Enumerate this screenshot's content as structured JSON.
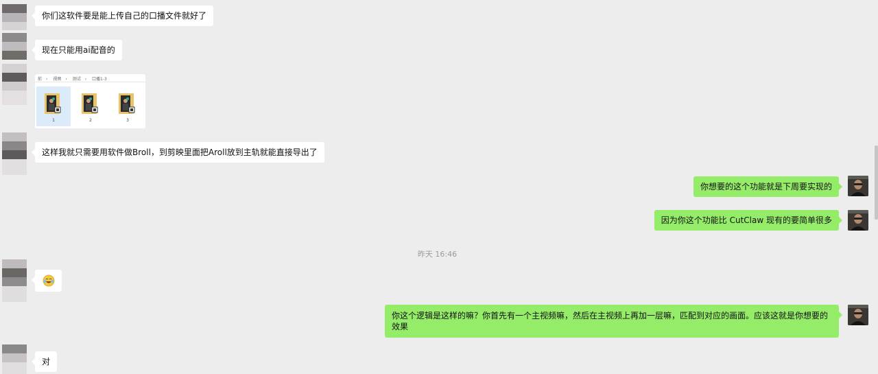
{
  "chat": {
    "messages": [
      {
        "text": "你们这软件要是能上传自己的口播文件就好了"
      },
      {
        "text": "现在只能用ai配音的"
      },
      {
        "text": "这样我就只需要用软件做Broll，到剪映里面把Aroll放到主轨就能直接导出了"
      },
      {
        "text": "你想要的这个功能就是下周要实现的"
      },
      {
        "text": "因为你这个功能比 CutClaw 现有的要简单很多"
      },
      {
        "text": "你这个逻辑是这样的嘛？你首先有一个主视频嘛，然后在主视频上再加一层嘛，匹配到对应的画面。应该这就是你想要的效果"
      },
      {
        "text": "对"
      }
    ],
    "timestamp": "昨天 16:46",
    "emoji": "cry-laugh-emoji",
    "screenshot": {
      "breadcrumb": [
        "前",
        "视频",
        "测试",
        "口播1-3"
      ],
      "separator": "›",
      "files": [
        "1",
        "2",
        "3"
      ]
    }
  },
  "colors": {
    "background": "#ededed",
    "incoming_bubble": "#ffffff",
    "outgoing_bubble": "#95ec69",
    "timestamp_text": "#9a9a9a"
  }
}
